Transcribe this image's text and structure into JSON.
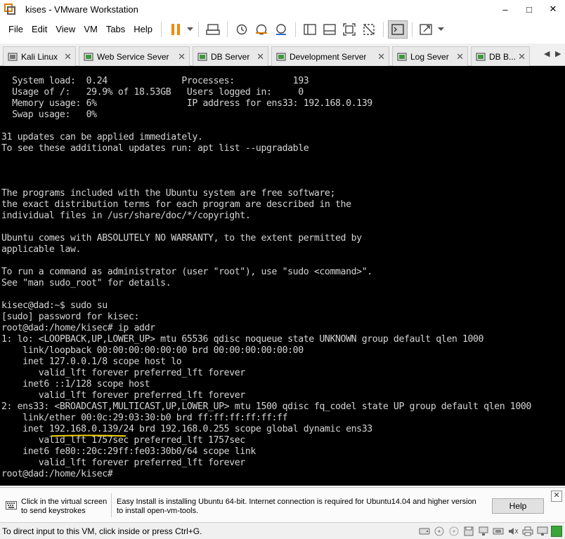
{
  "window": {
    "title": "kises - VMware Workstation",
    "controls": {
      "minimize": "–",
      "maximize": "□",
      "close": "✕"
    }
  },
  "menu": [
    "File",
    "Edit",
    "View",
    "VM",
    "Tabs",
    "Help"
  ],
  "toolbar_icons": [
    "pause-icon",
    "send-keys-icon",
    "snapshot-icon",
    "revert-snapshot-icon",
    "manage-snapshots-icon",
    "library-icon",
    "thumbnail-icon",
    "full-screen-icon",
    "unity-icon",
    "console-view-icon",
    "stretch-icon"
  ],
  "tabs": [
    {
      "label": "Kali Linux",
      "close": "✕"
    },
    {
      "label": "Web Service Sever",
      "close": "✕"
    },
    {
      "label": "DB Server",
      "close": "✕"
    },
    {
      "label": "Development Server",
      "close": "✕"
    },
    {
      "label": "Log Sever",
      "close": "✕"
    },
    {
      "label": "DB B...",
      "close": "✕"
    }
  ],
  "tab_scroll": {
    "left": "◀",
    "right": "▶"
  },
  "console_lines": [
    "  System load:  0.24              Processes:           193",
    "  Usage of /:   29.9% of 18.53GB   Users logged in:     0",
    "  Memory usage: 6%                 IP address for ens33: 192.168.0.139",
    "  Swap usage:   0%",
    "",
    "31 updates can be applied immediately.",
    "To see these additional updates run: apt list --upgradable",
    "",
    "",
    "",
    "The programs included with the Ubuntu system are free software;",
    "the exact distribution terms for each program are described in the",
    "individual files in /usr/share/doc/*/copyright.",
    "",
    "Ubuntu comes with ABSOLUTELY NO WARRANTY, to the extent permitted by",
    "applicable law.",
    "",
    "To run a command as administrator (user \"root\"), use \"sudo <command>\".",
    "See \"man sudo_root\" for details.",
    "",
    "kisec@dad:~$ sudo su",
    "[sudo] password for kisec:",
    "root@dad:/home/kisec# ip addr",
    "1: lo: <LOOPBACK,UP,LOWER_UP> mtu 65536 qdisc noqueue state UNKNOWN group default qlen 1000",
    "    link/loopback 00:00:00:00:00:00 brd 00:00:00:00:00:00",
    "    inet 127.0.0.1/8 scope host lo",
    "       valid_lft forever preferred_lft forever",
    "    inet6 ::1/128 scope host",
    "       valid_lft forever preferred_lft forever",
    "2: ens33: <BROADCAST,MULTICAST,UP,LOWER_UP> mtu 1500 qdisc fq_codel state UP group default qlen 1000",
    "    link/ether 00:0c:29:03:30:b0 brd ff:ff:ff:ff:ff:ff",
    "    inet 192.168.0.139/24 brd 192.168.0.255 scope global dynamic ens33",
    "       valid_lft 1757sec preferred_lft 1757sec",
    "    inet6 fe80::20c:29ff:fe03:30b0/64 scope link",
    "       valid_lft forever preferred_lft forever",
    "root@dad:/home/kisec#"
  ],
  "colors": {
    "console_bg": "#000000",
    "console_fg": "#d4d4d4",
    "highlight_underline": "#f2d300",
    "pause_orange": "#f08a00"
  },
  "infobar": {
    "hint_line1": "Click in the virtual screen",
    "hint_line2": "to send keystrokes",
    "message": "Easy Install is installing Ubuntu 64-bit. Internet connection is required for Ubuntu14.04 and higher version to install open-vm-tools.",
    "help_label": "Help",
    "close": "✕"
  },
  "statusbar": {
    "text": "To direct input to this VM, click inside or press Ctrl+G.",
    "icons": [
      "hard-disk-icon",
      "cd-icon",
      "floppy-icon",
      "network-icon",
      "usb-icon",
      "sound-icon",
      "printer-icon",
      "display-icon"
    ]
  }
}
